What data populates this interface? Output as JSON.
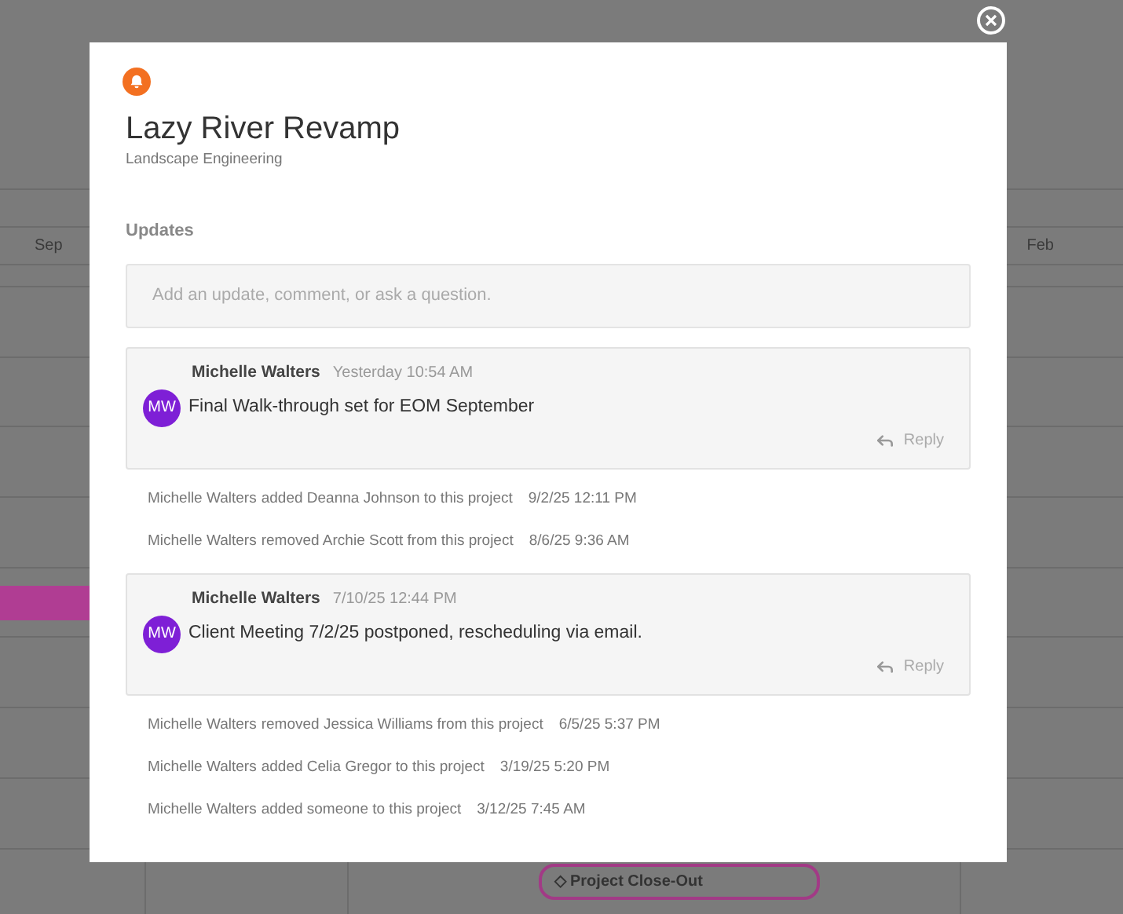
{
  "background": {
    "months": [
      {
        "label": "Sep"
      },
      {
        "label": "Feb"
      }
    ],
    "milestone": {
      "symbol": "◇",
      "label": "Project Close-Out"
    }
  },
  "modal": {
    "title": "Lazy River Revamp",
    "subtitle": "Landscape Engineering",
    "section_label": "Updates",
    "update_field": {
      "placeholder": "Add an update, comment, or ask a question."
    },
    "entries": [
      {
        "kind": "comment",
        "author": "Michelle Walters",
        "time": "Yesterday 10:54 AM",
        "initials": "MW",
        "color": "#7e1fd6",
        "text": "Final Walk-through set for EOM September",
        "reply": "Reply"
      },
      {
        "kind": "activity",
        "actor": "Michelle Walters",
        "action": "added Deanna Johnson to this project",
        "time": "9/2/25 12:11 PM"
      },
      {
        "kind": "activity",
        "actor": "Michelle Walters",
        "action": "removed Archie Scott from this project",
        "time": "8/6/25 9:36 AM"
      },
      {
        "kind": "comment",
        "author": "Michelle Walters",
        "time": "7/10/25 12:44 PM",
        "initials": "MW",
        "color": "#7e1fd6",
        "text": "Client Meeting 7/2/25 postponed, rescheduling via email.",
        "reply": "Reply"
      },
      {
        "kind": "activity",
        "actor": "Michelle Walters",
        "action": "removed Jessica Williams from this project",
        "time": "6/5/25 5:37 PM"
      },
      {
        "kind": "activity",
        "actor": "Michelle Walters",
        "action": "added Celia Gregor to this project",
        "time": "3/19/25 5:20 PM"
      },
      {
        "kind": "activity",
        "actor": "Michelle Walters",
        "action": "added someone to this project",
        "time": "3/12/25 7:45 AM"
      }
    ]
  }
}
